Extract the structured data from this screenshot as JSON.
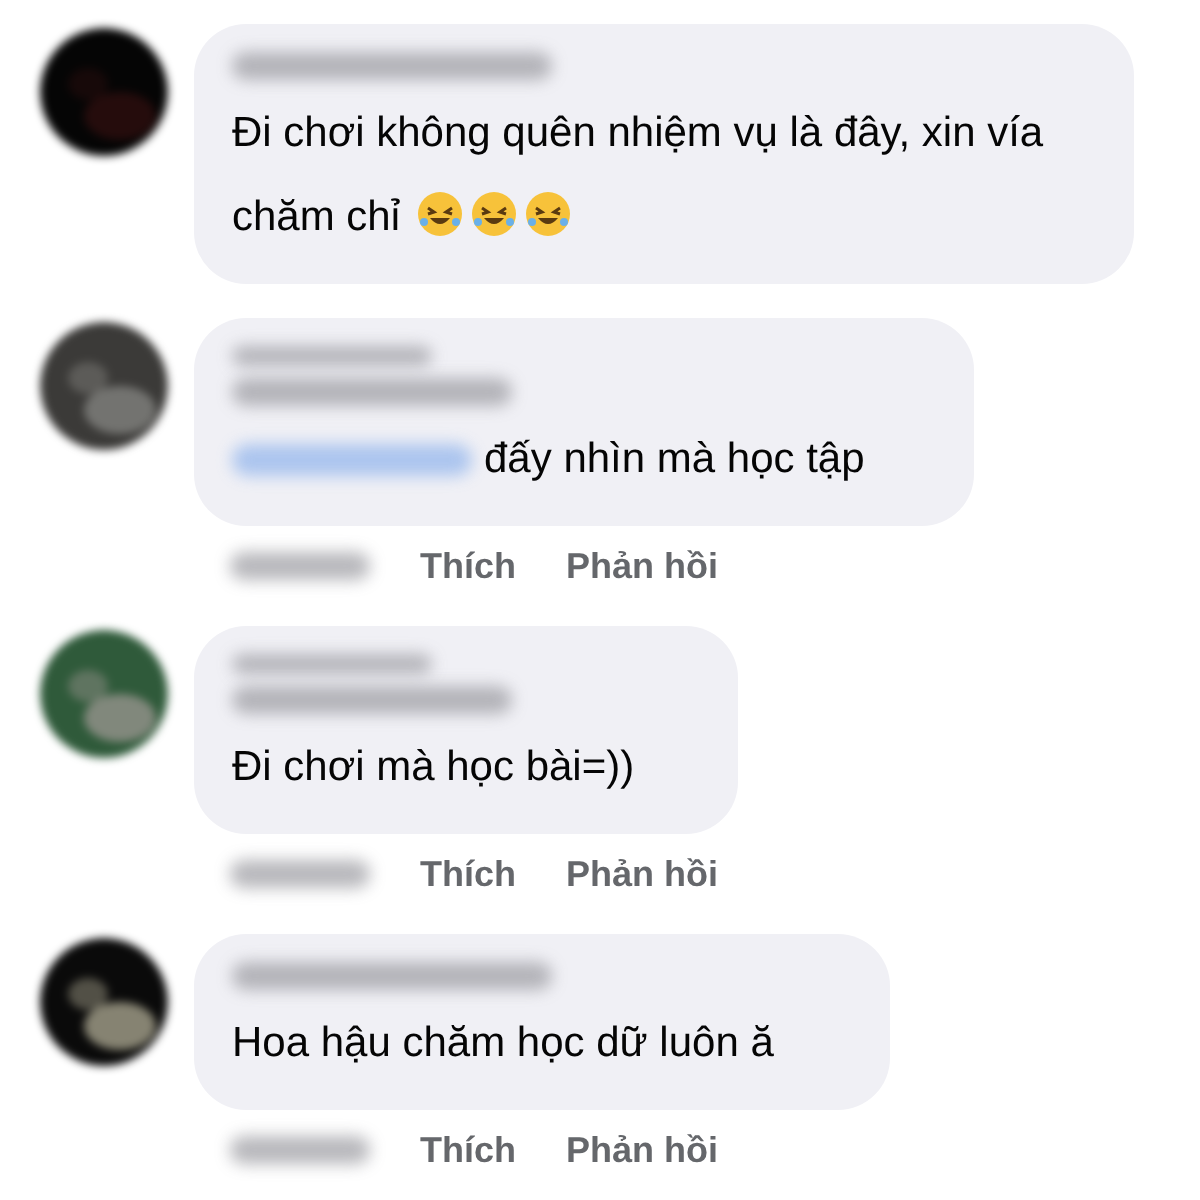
{
  "comments": [
    {
      "kind": "comment",
      "text": "Đi chơi không quên nhiệm vụ là đây, xin vía chăm chỉ",
      "emojis": [
        {
          "kind": "rofl"
        },
        {
          "kind": "rofl"
        },
        {
          "kind": "rofl"
        }
      ],
      "mention": false
    },
    {
      "kind": "reply",
      "text": "đấy nhìn mà học tập",
      "mention": true,
      "actions": [
        "Thích",
        "Phản hồi"
      ]
    },
    {
      "kind": "reply",
      "text": "Đi chơi mà học bài=))",
      "mention": false,
      "actions": [
        "Thích",
        "Phản hồi"
      ]
    },
    {
      "kind": "comment",
      "text": "Hoa hậu chăm học dữ luôn ă",
      "mention": false,
      "actions": [
        "Thích",
        "Phản hồi"
      ]
    }
  ]
}
